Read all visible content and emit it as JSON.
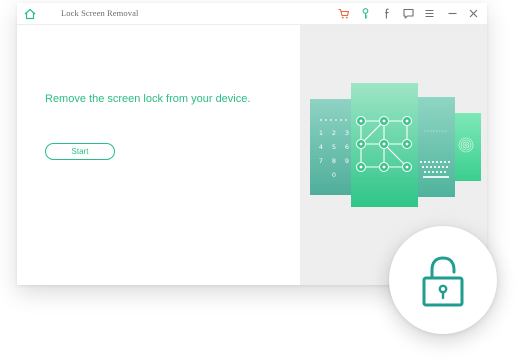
{
  "app": {
    "title": "Lock Screen Removal"
  },
  "toolbar": {
    "icons": [
      "home-icon",
      "cart-icon",
      "key-icon",
      "facebook-icon",
      "feedback-icon",
      "menu-icon",
      "minimize-icon",
      "close-icon"
    ],
    "cart_color": "#f0643c",
    "key_color": "#2bbd84"
  },
  "main": {
    "headline": "Remove the screen lock from your device.",
    "start_label": "Start"
  },
  "colors": {
    "accent": "#2bbd84",
    "lock_icon": "#1f9d8f",
    "panel_bg": "#eeeeee"
  },
  "illustration": {
    "keypad_digits": [
      "1",
      "2",
      "3",
      "4",
      "5",
      "6",
      "7",
      "8",
      "9",
      "0"
    ]
  }
}
